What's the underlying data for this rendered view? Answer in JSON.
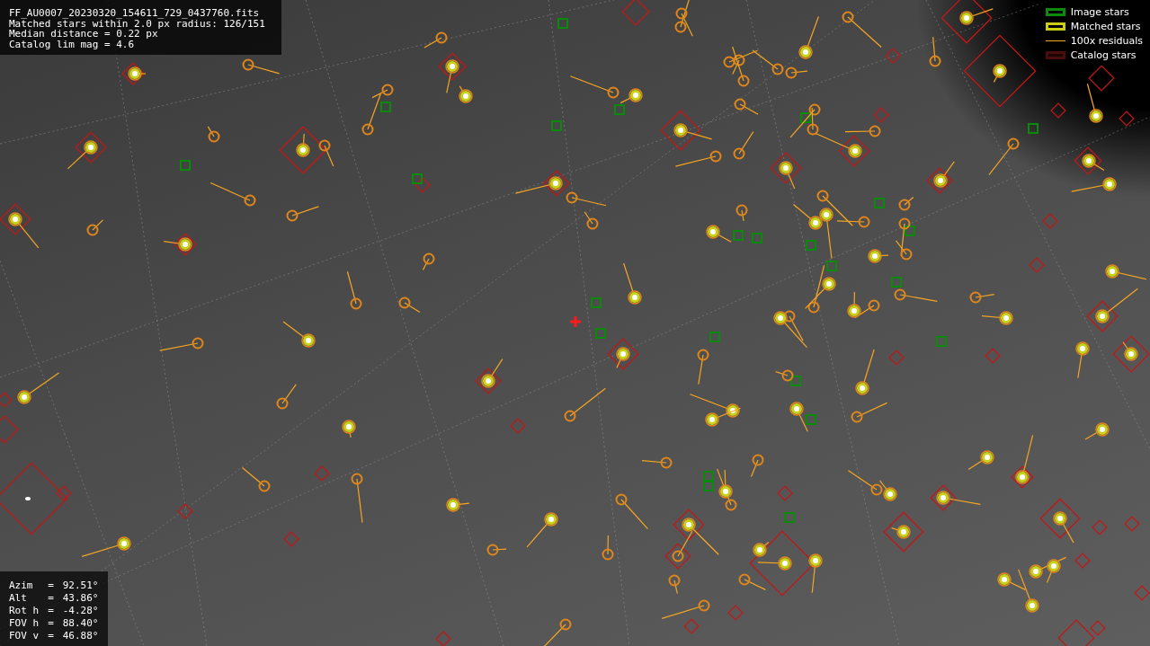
{
  "info_lines": [
    "FF_AU0007_20230320_154611_729_0437760.fits",
    "Matched stars within 2.0 px radius: 126/151",
    "Median distance = 0.22 px",
    "Catalog lim mag = 4.6"
  ],
  "legend": [
    {
      "kind": "image",
      "label": "Image stars"
    },
    {
      "kind": "matched",
      "label": "Matched stars"
    },
    {
      "kind": "residual",
      "label": "100x residuals"
    },
    {
      "kind": "catalog",
      "label": "Catalog stars"
    }
  ],
  "pointing": [
    {
      "label": "Azim",
      "sep": "=",
      "value": "92.51°"
    },
    {
      "label": "Alt",
      "sep": "=",
      "value": "43.86°"
    },
    {
      "label": "Rot h",
      "sep": "=",
      "value": "-4.28°"
    },
    {
      "label": "FOV h",
      "sep": "=",
      "value": "88.40°"
    },
    {
      "label": "FOV v",
      "sep": "=",
      "value": "46.88°"
    }
  ]
}
